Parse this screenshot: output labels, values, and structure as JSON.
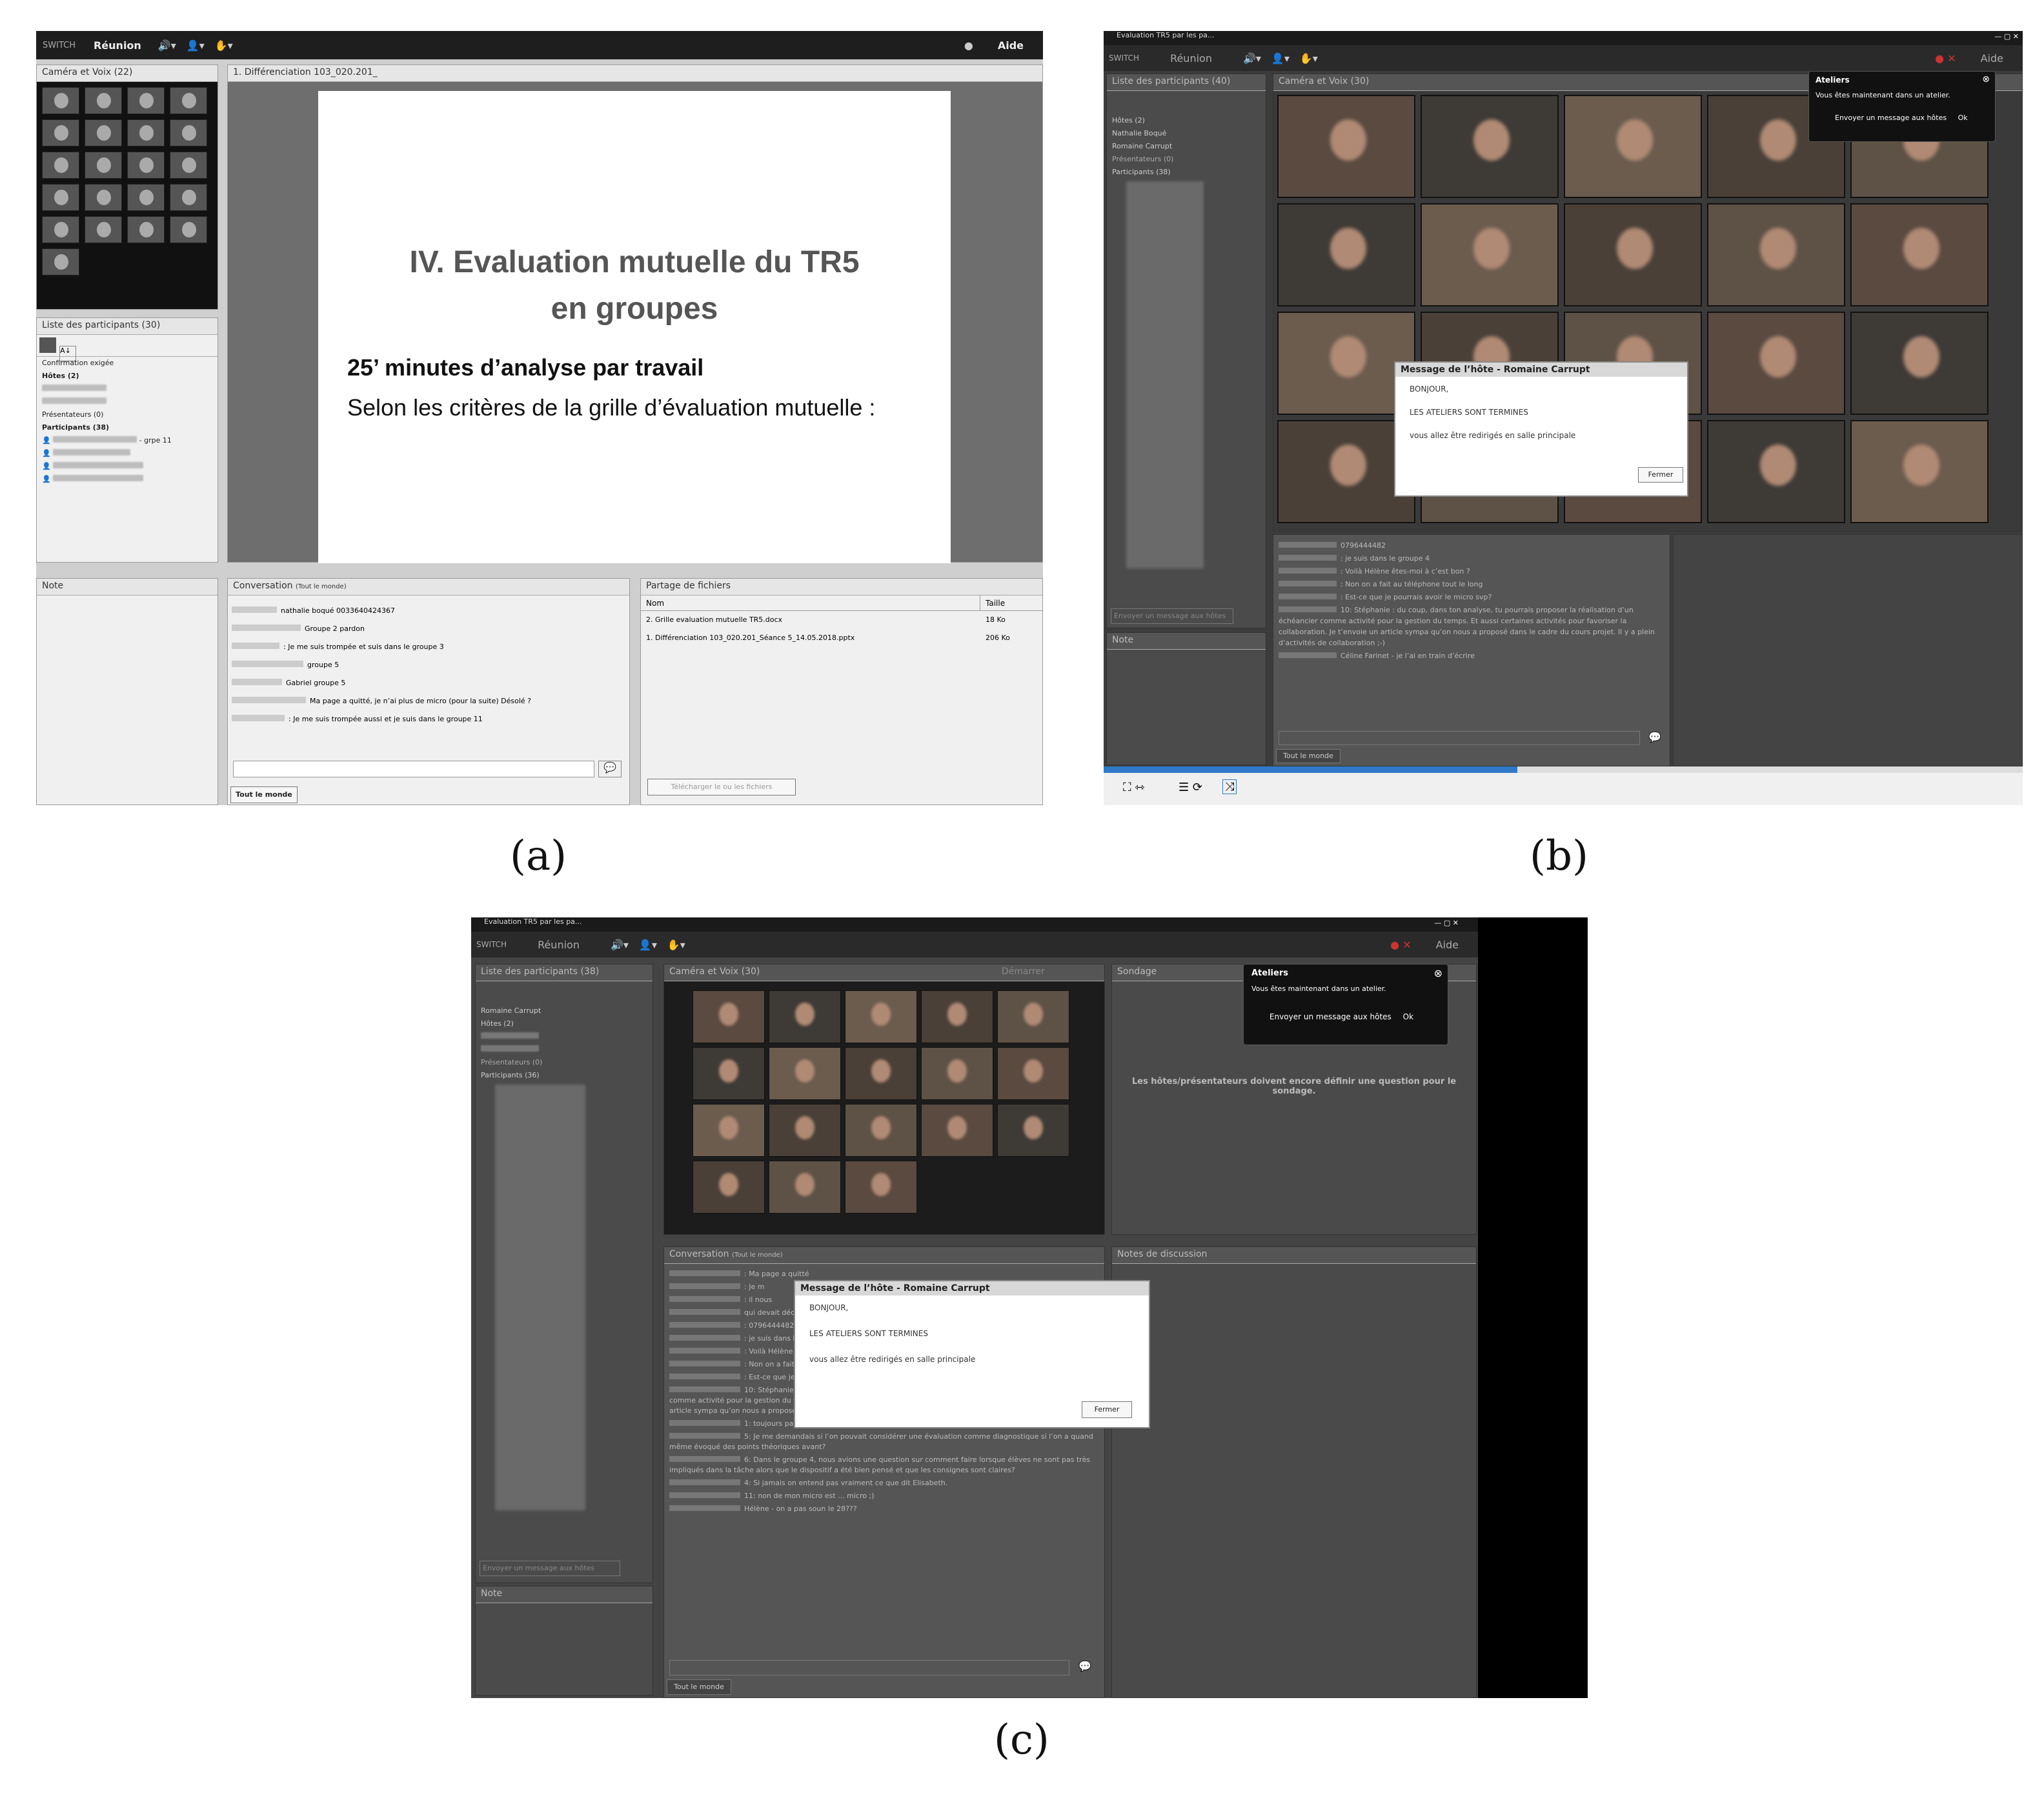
{
  "panel_a": {
    "label": "(a)",
    "toolbar": {
      "brand": "SWITCH",
      "meeting": "Réunion",
      "help": "Aide"
    },
    "camera": {
      "title": "Caméra et Voix",
      "count": "(22)"
    },
    "slide": {
      "tab": "1. Différenciation 103_020.201_",
      "title_line1": "IV. Evaluation mutuelle du TR5",
      "title_line2": "en groupes",
      "subtitle": "25’ minutes d’analyse par travail",
      "body": "Selon les critères de la grille d’évaluation mutuelle :"
    },
    "participants": {
      "title": "Liste des participants",
      "count": "(30)",
      "connection": "Confirmation exigée",
      "hosts": "Hôtes (2)",
      "presenters": "Présentateurs (0)",
      "participants_group": "Participants (38)",
      "first_participant": "- grpe 11"
    },
    "note": {
      "title": "Note"
    },
    "conversation": {
      "title": "Conversation",
      "scope": "(Tout le monde)",
      "messages": [
        "nathalie boqué 0033640424367",
        "Groupe 2 pardon",
        ": Je me suis trompée et suis dans le groupe 3",
        "groupe 5",
        "Gabriel groupe 5",
        "Ma page a quitté, je n’ai plus de micro (pour la suite) Désolé ?",
        ": Je me suis trompée aussi et je suis dans le groupe 11"
      ],
      "tab": "Tout le monde"
    },
    "files": {
      "title": "Partage de fichiers",
      "col_name": "Nom",
      "col_size": "Taille",
      "rows": [
        {
          "name": "2. Grille evaluation mutuelle TR5.docx",
          "size": "18 Ko"
        },
        {
          "name": "1. Différenciation 103_020.201_Séance 5_14.05.2018.pptx",
          "size": "206 Ko"
        }
      ],
      "download": "Télécharger le ou les fichiers"
    }
  },
  "panel_b": {
    "label": "(b)",
    "window_title": "Evaluation TR5 par les pa...",
    "toolbar": {
      "brand": "SWITCH",
      "meeting": "Réunion",
      "help": "Aide"
    },
    "participants": {
      "title": "Liste des participants",
      "count": "(40)",
      "hosts": "Hôtes (2)",
      "host1": "Nathalie Boqué",
      "host2": "Romaine Carrupt",
      "presenters": "Présentateurs (0)",
      "participants_group": "Participants (38)"
    },
    "camera": {
      "title": "Caméra et Voix",
      "count": "(30)"
    },
    "note": {
      "title": "Note"
    },
    "chat_input_placeholder": "Envoyer un message aux hôtes",
    "chat_lines": [
      "0796444482",
      ": je suis dans le groupe 4",
      ": Voilà Hélène êtes-moi à c’est bon ?",
      ": Non on a fait au téléphone tout le long",
      ": Est-ce que je pourrais avoir le micro svp?",
      "10: Stéphanie : du coup, dans ton analyse, tu pourrais proposer la réalisation d’un échéancier comme activité pour la gestion du temps. Et aussi certaines activités pour favoriser la collaboration. Je t’envoie un article sympa qu’on nous a proposé dans le cadre du cours projet. Il y a plein d’activités de collaboration ;-)",
      "Céline Farinet - je l’ai en train d’écrire"
    ],
    "chat_tab": "Tout le monde",
    "ateliers": {
      "title": "Ateliers",
      "text": "Vous êtes maintenant dans un atelier.",
      "link": "Envoyer un message aux hôtes",
      "ok": "Ok"
    },
    "dialog": {
      "title": "Message de l’hôte - Romaine Carrupt",
      "line1": "BONJOUR,",
      "line2": "LES ATELIERS SONT TERMINES",
      "line3": "vous allez être redirigés en salle principale",
      "close": "Fermer"
    }
  },
  "panel_c": {
    "label": "(c)",
    "window_title": "Evaluation TR5 par les pa...",
    "toolbar": {
      "brand": "SWITCH",
      "meeting": "Réunion",
      "help": "Aide"
    },
    "participants": {
      "title": "Liste des participants",
      "count": "(38)",
      "connection": "Romaine Carrupt",
      "hosts": "Hôtes (2)",
      "presenters": "Présentateurs (0)",
      "participants_group": "Participants (36)"
    },
    "chat_input_placeholder": "Envoyer un message aux hôtes",
    "note": {
      "title": "Note"
    },
    "camera": {
      "title": "Caméra et Voix",
      "count": "(30)",
      "button": "Démarrer"
    },
    "poll": {
      "title": "Sondage",
      "text": "Les hôtes/présentateurs doivent encore définir une question pour le sondage."
    },
    "ateliers": {
      "title": "Ateliers",
      "text": "Vous êtes maintenant dans un atelier.",
      "link": "Envoyer un message aux hôtes",
      "ok": "Ok"
    },
    "conversation": {
      "title": "Conversation",
      "scope": "(Tout le monde)",
      "messages": [
        ": Ma page a quitté",
        ": Je m",
        ": il nous",
        "qui devait décaler le travail d’",
        ": 0796444482",
        ": je suis dans le groupe",
        ": Voilà Hélène",
        ": Non on a fait au télép",
        ": Est-ce que je",
        "10: Stéphanie : du coup, dans ton analyse, tu pourrais proposer la réalisation d’un échéancier comme activité pour la gestion du temps. Et aussi certaines activités pour favoriser la collaboration. Je t’envoie un article sympa qu’on nous a proposé dans le cadre du cours projet. Il y a plein d’activités de collaboration ;-)",
        "1: toujours pas de micro",
        "5: Je me demandais si l’on pouvait considérer une évaluation comme diagnostique si l’on a quand même évoqué des points théoriques avant?",
        "6: Dans le groupe 4, nous avions une question sur comment faire lorsque élèves ne sont pas très impliqués dans la tâche alors que le dispositif a été bien pensé et que les consignes sont claires?",
        "4: Si jamais on entend pas vraiment ce que dit Elisabeth.",
        "11: non de mon micro est ... micro ;)",
        "Hélène - on a pas soun le 28???"
      ],
      "tab": "Tout le monde"
    },
    "notes": {
      "title": "Notes de discussion"
    },
    "dialog": {
      "title": "Message de l’hôte - Romaine Carrupt",
      "line1": "BONJOUR,",
      "line2": "LES ATELIERS SONT TERMINES",
      "line3": "vous allez être redirigés en salle principale",
      "close": "Fermer"
    }
  }
}
